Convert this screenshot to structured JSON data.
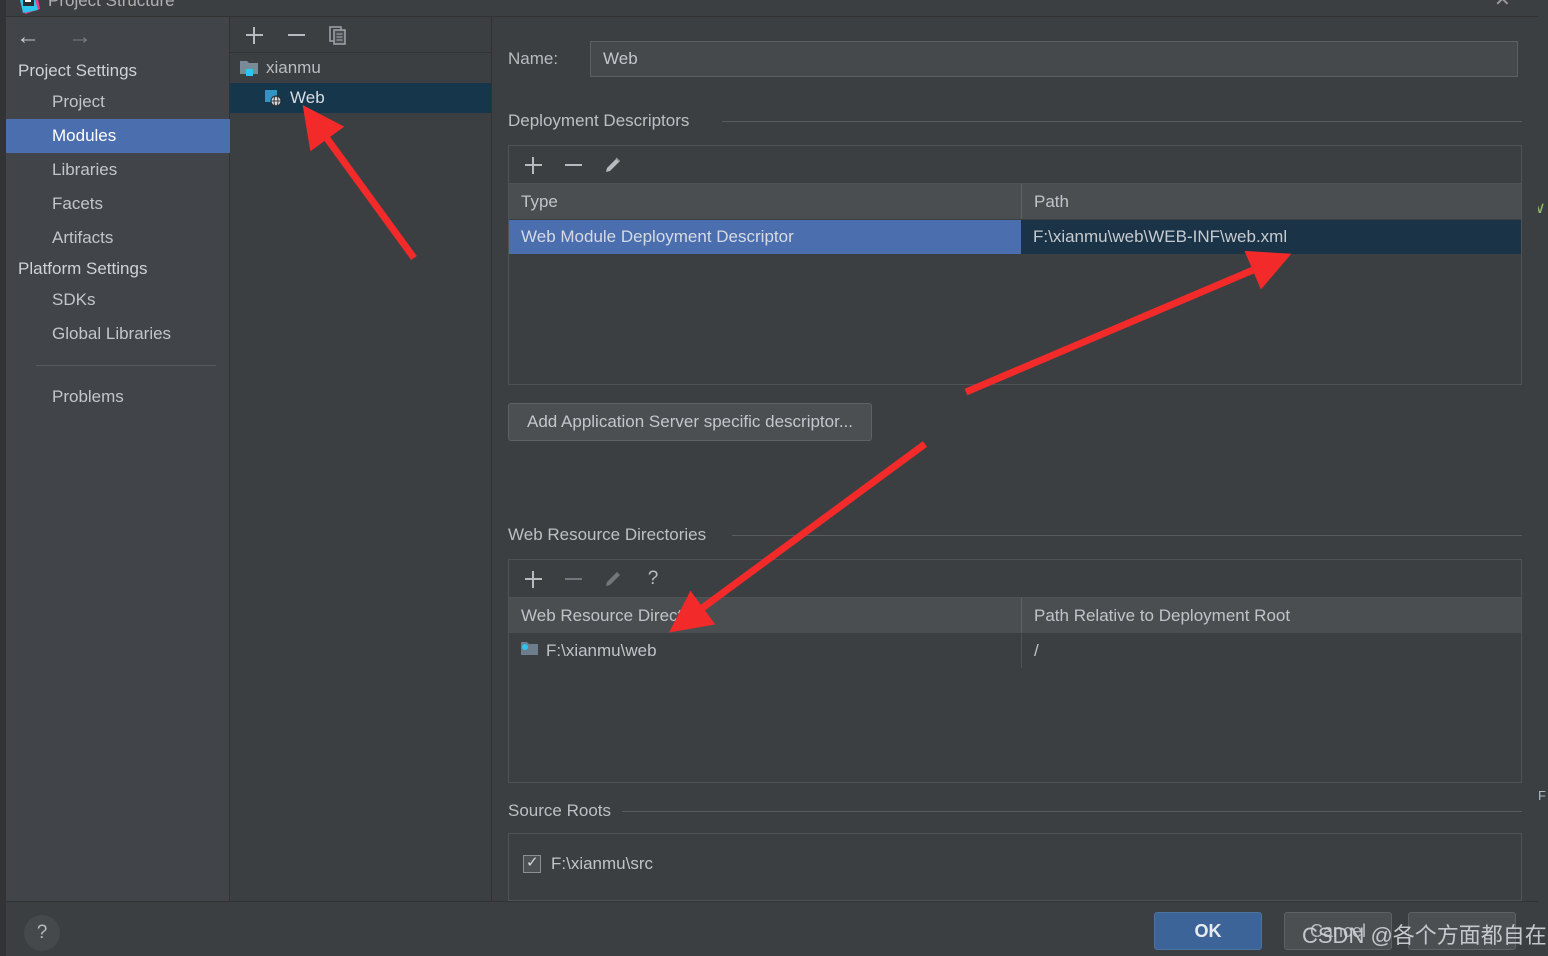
{
  "window": {
    "title": "Project Structure",
    "close_label": "✕",
    "app_icon": "intellij-idea-icon"
  },
  "nav": {
    "back": "←",
    "forward": "→"
  },
  "sidebar": {
    "groups": [
      {
        "label": "Project Settings",
        "items": [
          {
            "label": "Project",
            "selected": false
          },
          {
            "label": "Modules",
            "selected": true
          },
          {
            "label": "Libraries",
            "selected": false
          },
          {
            "label": "Facets",
            "selected": false
          },
          {
            "label": "Artifacts",
            "selected": false
          }
        ]
      },
      {
        "label": "Platform Settings",
        "items": [
          {
            "label": "SDKs",
            "selected": false
          },
          {
            "label": "Global Libraries",
            "selected": false
          }
        ]
      }
    ],
    "problems_label": "Problems"
  },
  "module_tree": {
    "toolbar": [
      {
        "name": "add-module-button",
        "glyph": "plus"
      },
      {
        "name": "remove-module-button",
        "glyph": "minus"
      },
      {
        "name": "copy-module-button",
        "glyph": "copy"
      }
    ],
    "nodes": [
      {
        "label": "xianmu",
        "icon": "module-folder-icon",
        "selected": false,
        "child": false
      },
      {
        "label": "Web",
        "icon": "web-facet-icon",
        "selected": true,
        "child": true
      }
    ]
  },
  "main": {
    "name_field": {
      "label": "Name:",
      "value": "Web",
      "placeholder": ""
    },
    "deployment_descriptors": {
      "title": "Deployment Descriptors",
      "toolbar": [
        {
          "name": "add-descriptor-button",
          "glyph": "plus",
          "enabled": true
        },
        {
          "name": "remove-descriptor-button",
          "glyph": "minus",
          "enabled": true
        },
        {
          "name": "edit-descriptor-button",
          "glyph": "pencil",
          "enabled": true
        }
      ],
      "columns": [
        "Type",
        "Path"
      ],
      "rows": [
        {
          "type": "Web Module Deployment Descriptor",
          "path": "F:\\xianmu\\web\\WEB-INF\\web.xml",
          "selected": true
        }
      ],
      "add_server_descriptor_label": "Add Application Server specific descriptor..."
    },
    "web_resource_directories": {
      "title": "Web Resource Directories",
      "toolbar": [
        {
          "name": "add-web-resource-button",
          "glyph": "plus",
          "enabled": true
        },
        {
          "name": "remove-web-resource-button",
          "glyph": "minus",
          "enabled": false
        },
        {
          "name": "edit-web-resource-button",
          "glyph": "pencil",
          "enabled": false
        },
        {
          "name": "web-resource-help-button",
          "glyph": "question",
          "enabled": true
        }
      ],
      "columns": [
        "Web Resource Directory",
        "Path Relative to Deployment Root"
      ],
      "rows": [
        {
          "directory": "F:\\xianmu\\web",
          "relative_path": "/",
          "icon": "folder-web-icon"
        }
      ]
    },
    "source_roots": {
      "title": "Source Roots",
      "rows": [
        {
          "label": "F:\\xianmu\\src",
          "checked": true
        }
      ]
    }
  },
  "footer": {
    "help_label": "?",
    "ok_label": "OK",
    "cancel_label": "Cancel"
  },
  "watermark": {
    "text": "CSDN @各个方面都自在"
  },
  "background": {
    "check_glyph": "∨",
    "f_glyph": "F"
  },
  "colors": {
    "dialog_bg": "#3c3f41",
    "sidebar_bg": "#41454a",
    "selection_blue": "#4b6eaf",
    "tree_selection": "#16364c",
    "table_selection_navy": "#1b3347",
    "ok_button": "#3c6498",
    "annotation_red": "#f22a2a",
    "text_primary": "#c0c4c8"
  }
}
